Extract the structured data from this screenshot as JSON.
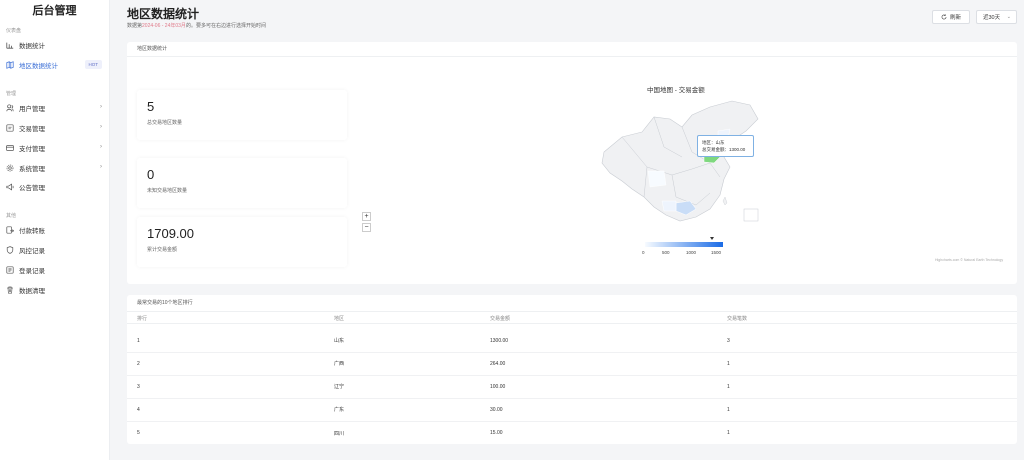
{
  "app": {
    "title": "后台管理"
  },
  "sidebar": {
    "sections": [
      {
        "label": "仪表盘"
      },
      {
        "label": "管理"
      },
      {
        "label": "其他"
      }
    ],
    "items": [
      {
        "label": "数据统计",
        "icon": "bar-chart-icon"
      },
      {
        "label": "地区数据统计",
        "icon": "map-icon",
        "badge": "HOT",
        "active": true
      },
      {
        "label": "用户管理",
        "icon": "users-icon",
        "has_children": true
      },
      {
        "label": "交易管理",
        "icon": "transaction-icon",
        "has_children": true
      },
      {
        "label": "支付管理",
        "icon": "credit-card-icon",
        "has_children": true
      },
      {
        "label": "系统管理",
        "icon": "gear-icon",
        "has_children": true
      },
      {
        "label": "公告管理",
        "icon": "megaphone-icon"
      },
      {
        "label": "付款转账",
        "icon": "transfer-icon"
      },
      {
        "label": "风控记录",
        "icon": "shield-icon"
      },
      {
        "label": "登录记录",
        "icon": "login-log-icon"
      },
      {
        "label": "数据清理",
        "icon": "trash-icon"
      }
    ],
    "accent_color": "#3b6fd6"
  },
  "header": {
    "title": "地区数据统计",
    "subtitle_prefix": "数据第",
    "subtitle_range": "2024-06 - 24年03月",
    "subtitle_suffix": "的。要多可在右边进行选择开始时间",
    "refresh_label": "刷新",
    "range_value": "近30天"
  },
  "map_panel": {
    "heading": "地区数据统计",
    "stats": [
      {
        "value": "5",
        "label": "总交易地区数量"
      },
      {
        "value": "0",
        "label": "未知交易地区数量"
      },
      {
        "value": "1709.00",
        "label": "累计交易金额"
      }
    ],
    "zoom_in": "+",
    "zoom_out": "−",
    "map_title": "中国地图 - 交易金额",
    "tooltip": {
      "region_line": "地区：山东",
      "amount_line": "总交易金额：1300.00"
    },
    "legend_ticks": [
      "0",
      "500",
      "1000",
      "1500"
    ],
    "credit": "Highcharts.com © Natural Earth Technology",
    "colors": {
      "low": "#f7fbff",
      "high": "#1a6be6",
      "highlight": "#7fd87f"
    }
  },
  "table": {
    "heading": "最常交易的10个地区排行",
    "columns": [
      "排行",
      "地区",
      "交易金额",
      "交易笔数"
    ],
    "rows": [
      [
        "1",
        "山东",
        "1300.00",
        "3"
      ],
      [
        "2",
        "广西",
        "264.00",
        "1"
      ],
      [
        "3",
        "辽宁",
        "100.00",
        "1"
      ],
      [
        "4",
        "广东",
        "30.00",
        "1"
      ],
      [
        "5",
        "四川",
        "15.00",
        "1"
      ]
    ]
  }
}
